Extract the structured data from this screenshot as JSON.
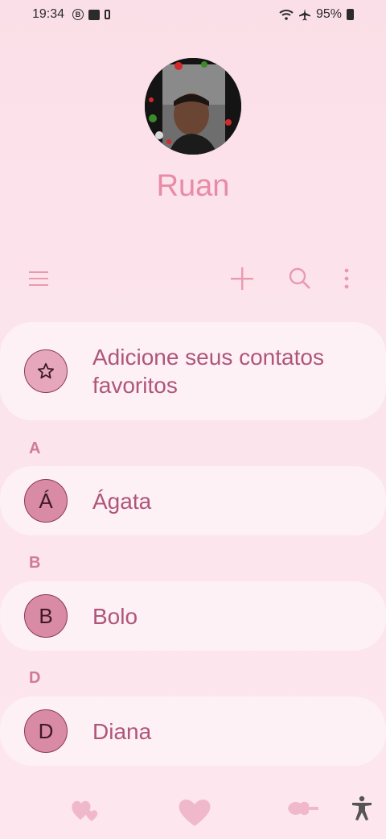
{
  "status_bar": {
    "time": "19:34",
    "b_badge": "B",
    "battery": "95%"
  },
  "profile": {
    "name": "Ruan"
  },
  "toolbar": {
    "menu_icon": "menu-icon",
    "add_icon": "plus-icon",
    "search_icon": "search-icon",
    "more_icon": "more-vert-icon"
  },
  "favorites": {
    "text_line1": "Adicione seus contatos",
    "text_line2": "favoritos",
    "icon": "star-icon"
  },
  "sections": [
    {
      "letter": "A",
      "contacts": [
        {
          "initial": "Á",
          "name": "Ágata"
        }
      ]
    },
    {
      "letter": "B",
      "contacts": [
        {
          "initial": "B",
          "name": "Bolo"
        }
      ]
    },
    {
      "letter": "D",
      "contacts": [
        {
          "initial": "D",
          "name": "Diana"
        }
      ]
    }
  ],
  "bottom_bar": {
    "icons": [
      "hearts-icon",
      "heart-icon",
      "back-arrow-icon",
      "accessibility-icon"
    ]
  },
  "colors": {
    "accent": "#e88aa8",
    "card": "#fdf1f5",
    "avatar_fill": "#d98aa5"
  }
}
